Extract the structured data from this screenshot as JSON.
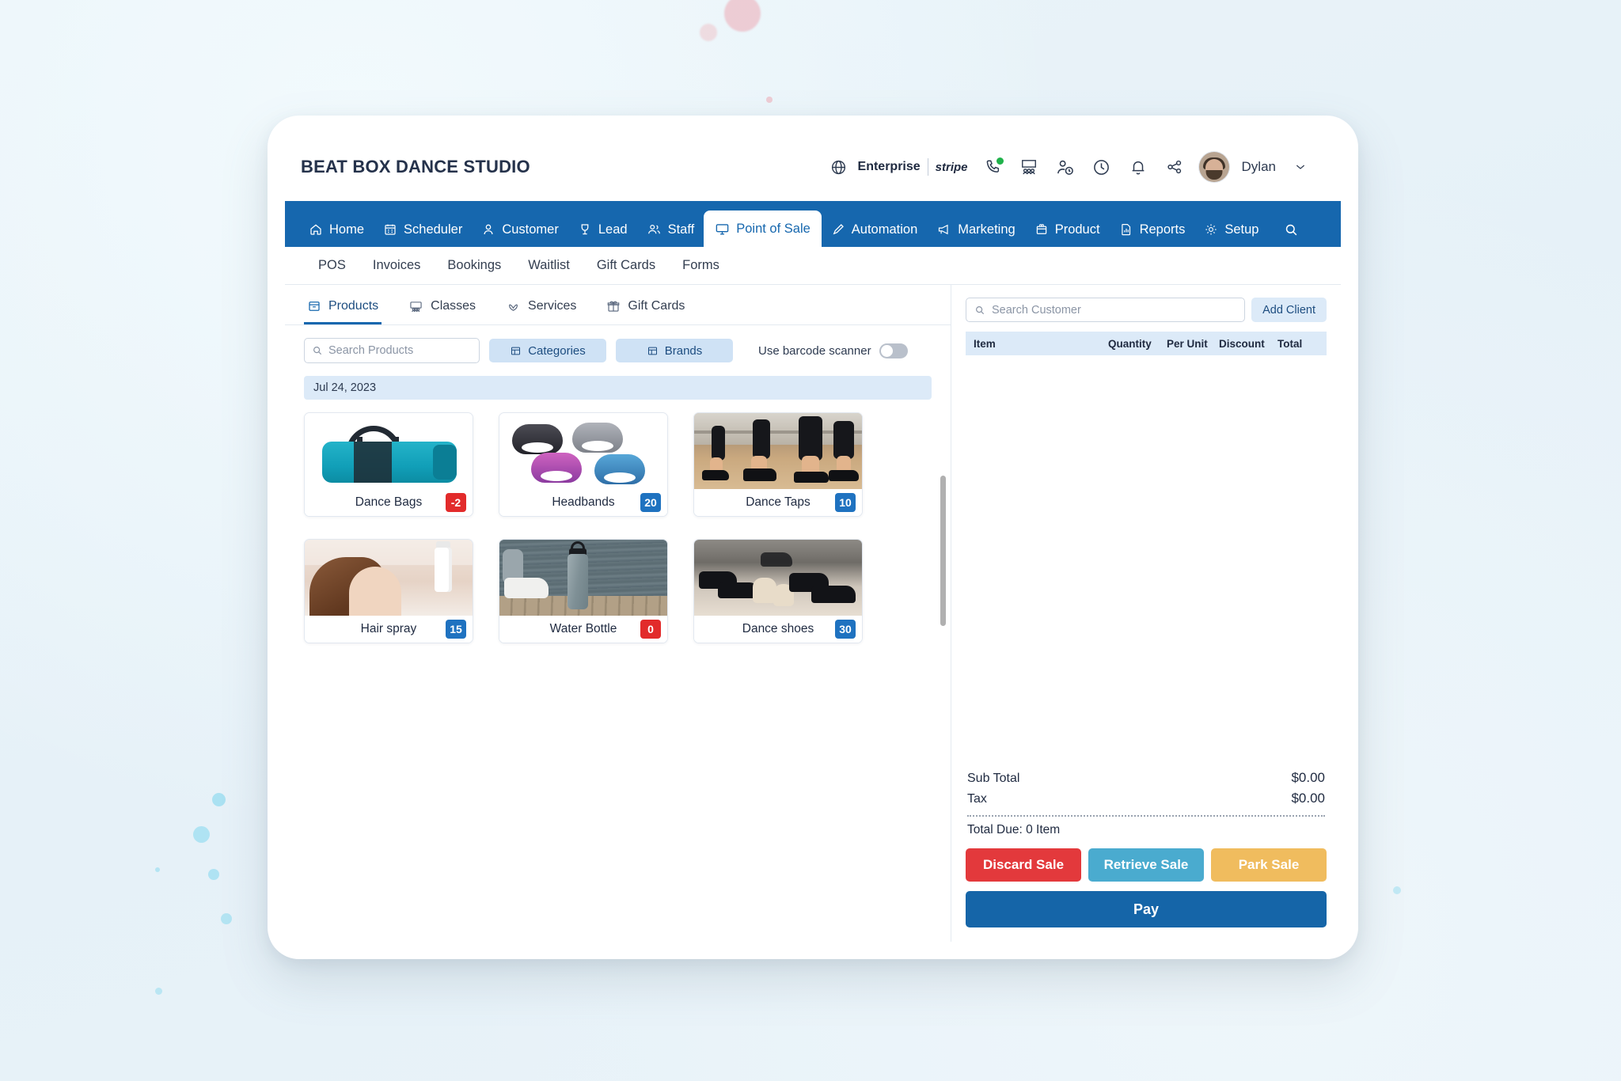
{
  "header": {
    "brand_title": "BEAT BOX DANCE STUDIO",
    "plan_label": "Enterprise",
    "payment_label": "stripe",
    "user_name": "Dylan",
    "icons": [
      "globe-icon",
      "phone-icon",
      "meeting-icon",
      "person-clock-icon",
      "clock-icon",
      "bell-icon",
      "share-icon"
    ]
  },
  "main_nav": {
    "items": [
      {
        "label": "Home",
        "icon": "home-icon",
        "active": false
      },
      {
        "label": "Scheduler",
        "icon": "calendar-icon",
        "active": false
      },
      {
        "label": "Customer",
        "icon": "person-icon",
        "active": false
      },
      {
        "label": "Lead",
        "icon": "trophy-icon",
        "active": false
      },
      {
        "label": "Staff",
        "icon": "people-icon",
        "active": false
      },
      {
        "label": "Point of Sale",
        "icon": "monitor-icon",
        "active": true
      },
      {
        "label": "Automation",
        "icon": "pen-icon",
        "active": false
      },
      {
        "label": "Marketing",
        "icon": "megaphone-icon",
        "active": false
      },
      {
        "label": "Product",
        "icon": "box-icon",
        "active": false
      },
      {
        "label": "Reports",
        "icon": "report-icon",
        "active": false
      },
      {
        "label": "Setup",
        "icon": "gear-icon",
        "active": false
      }
    ],
    "search_icon": "search-icon"
  },
  "sub_nav": {
    "items": [
      "POS",
      "Invoices",
      "Bookings",
      "Waitlist",
      "Gift Cards",
      "Forms"
    ]
  },
  "catalog": {
    "tabs": [
      {
        "label": "Products",
        "icon": "drawer-icon",
        "active": true
      },
      {
        "label": "Classes",
        "icon": "classes-icon",
        "active": false
      },
      {
        "label": "Services",
        "icon": "lotus-icon",
        "active": false
      },
      {
        "label": "Gift Cards",
        "icon": "gift-icon",
        "active": false
      }
    ],
    "search_placeholder": "Search Products",
    "categories_label": "Categories",
    "brands_label": "Brands",
    "barcode_label": "Use barcode scanner",
    "barcode_enabled": false,
    "date_label": "Jul 24, 2023",
    "products": [
      {
        "name": "Dance Bags",
        "qty": "-2",
        "qty_state": "negative",
        "art": "bag"
      },
      {
        "name": "Headbands",
        "qty": "20",
        "qty_state": "normal",
        "art": "headbands"
      },
      {
        "name": "Dance Taps",
        "qty": "10",
        "qty_state": "normal",
        "art": "taps"
      },
      {
        "name": "Hair spray",
        "qty": "15",
        "qty_state": "normal",
        "art": "hairspray"
      },
      {
        "name": "Water Bottle",
        "qty": "0",
        "qty_state": "negative",
        "art": "bottle"
      },
      {
        "name": "Dance shoes",
        "qty": "30",
        "qty_state": "normal",
        "art": "shoes"
      }
    ]
  },
  "cart": {
    "customer_placeholder": "Search Customer",
    "add_client_label": "Add Client",
    "columns": [
      "Item",
      "Quantity",
      "Per Unit",
      "Discount",
      "Total"
    ],
    "sub_total_label": "Sub Total",
    "sub_total_value": "$0.00",
    "tax_label": "Tax",
    "tax_value": "$0.00",
    "total_due_label": "Total Due: 0 Item",
    "discard_label": "Discard Sale",
    "retrieve_label": "Retrieve Sale",
    "park_label": "Park Sale",
    "pay_label": "Pay"
  },
  "colors": {
    "nav_blue": "#1667ae",
    "accent_blue": "#1f72c0",
    "danger_red": "#e22b2b",
    "retrieve_blue": "#4aabcf",
    "park_amber": "#f0bc5e",
    "pay_blue": "#1565a8",
    "page_bg": "#e8f2f8"
  }
}
